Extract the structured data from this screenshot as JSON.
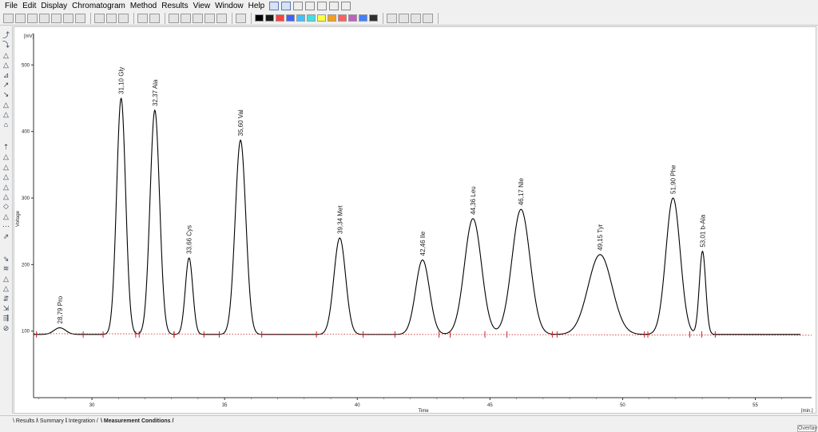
{
  "menu": [
    "File",
    "Edit",
    "Display",
    "Chromatogram",
    "Method",
    "Results",
    "View",
    "Window",
    "Help"
  ],
  "toolbar": {
    "icons": [
      "open-icon",
      "save-icon",
      "close-icon",
      "export-icon",
      "print-icon",
      "print-preview-icon",
      "print-report-icon",
      "cut-icon",
      "copy-icon",
      "paste-icon",
      "undo-icon",
      "redo-icon",
      "zoom-in-icon",
      "zoom-out-icon",
      "zoom-fit-icon",
      "edit-icon",
      "comment-icon",
      "spectrum-icon"
    ],
    "swatch_colors": [
      "#000000",
      "#1a1a1a",
      "#ff4040",
      "#4060ff",
      "#40c0ff",
      "#40e0e0",
      "#ffff40",
      "#f0a020",
      "#ff6060",
      "#c060c0",
      "#4080ff",
      "#303030"
    ],
    "nav_icons": [
      "first-icon",
      "previous-icon",
      "next-icon",
      "last-icon"
    ]
  },
  "left_tools": [
    "peak-tool-icon",
    "baseline-tool-icon",
    "integration-icon",
    "split-peak-icon",
    "merge-peak-icon",
    "tangent-icon",
    "drop-line-icon",
    "valley-icon",
    "negative-peak-icon",
    "shoulder-icon",
    "front-tangent-icon",
    "rear-tangent-icon",
    "lock-icon",
    "unlock-icon",
    "add-peak-icon",
    "delete-peak-icon",
    "move-baseline-icon",
    "reset-icon",
    "event-icon",
    "filter-icon",
    "smooth-icon",
    "noise-icon",
    "threshold-icon",
    "width-icon",
    "area-icon",
    "height-icon",
    "group-icon",
    "calibrate-icon"
  ],
  "tabs": [
    "Results",
    "Summary",
    "Integration",
    "Measurement Conditions"
  ],
  "active_tab": "Measurement Conditions",
  "status": {
    "overlay": "Overlay"
  },
  "chart_data": {
    "type": "line",
    "ylabel": "Voltage",
    "yunit": "[mV]",
    "xlabel": "Time",
    "xunit": "[min.]",
    "xlim": [
      27.8,
      56.7
    ],
    "ylim": [
      0,
      540
    ],
    "xticks": [
      30,
      35,
      40,
      45,
      50,
      55
    ],
    "yticks": [
      100,
      200,
      300,
      400,
      500
    ],
    "baseline": 95,
    "peaks": [
      {
        "label": "28,79 Pro",
        "rt": 28.79,
        "height": 105,
        "sigma": 0.22
      },
      {
        "label": "31,10 Gly",
        "rt": 31.1,
        "height": 450,
        "sigma": 0.17
      },
      {
        "label": "32,37 Ala",
        "rt": 32.37,
        "height": 432,
        "sigma": 0.18
      },
      {
        "label": "33,66 Cys",
        "rt": 33.66,
        "height": 210,
        "sigma": 0.14
      },
      {
        "label": "35,60 Val",
        "rt": 35.6,
        "height": 387,
        "sigma": 0.2
      },
      {
        "label": "39,34 Met",
        "rt": 39.34,
        "height": 240,
        "sigma": 0.22
      },
      {
        "label": "42,46 Ile",
        "rt": 42.46,
        "height": 207,
        "sigma": 0.26
      },
      {
        "label": "44,36 Leu",
        "rt": 44.36,
        "height": 269,
        "sigma": 0.32
      },
      {
        "label": "46,17 Nle",
        "rt": 46.17,
        "height": 283,
        "sigma": 0.34
      },
      {
        "label": "49,15 Tyr",
        "rt": 49.15,
        "height": 215,
        "sigma": 0.45
      },
      {
        "label": "51,90 Phe",
        "rt": 51.9,
        "height": 300,
        "sigma": 0.27
      },
      {
        "label": "53,01 b-Ala",
        "rt": 53.01,
        "height": 220,
        "sigma": 0.12
      }
    ]
  }
}
